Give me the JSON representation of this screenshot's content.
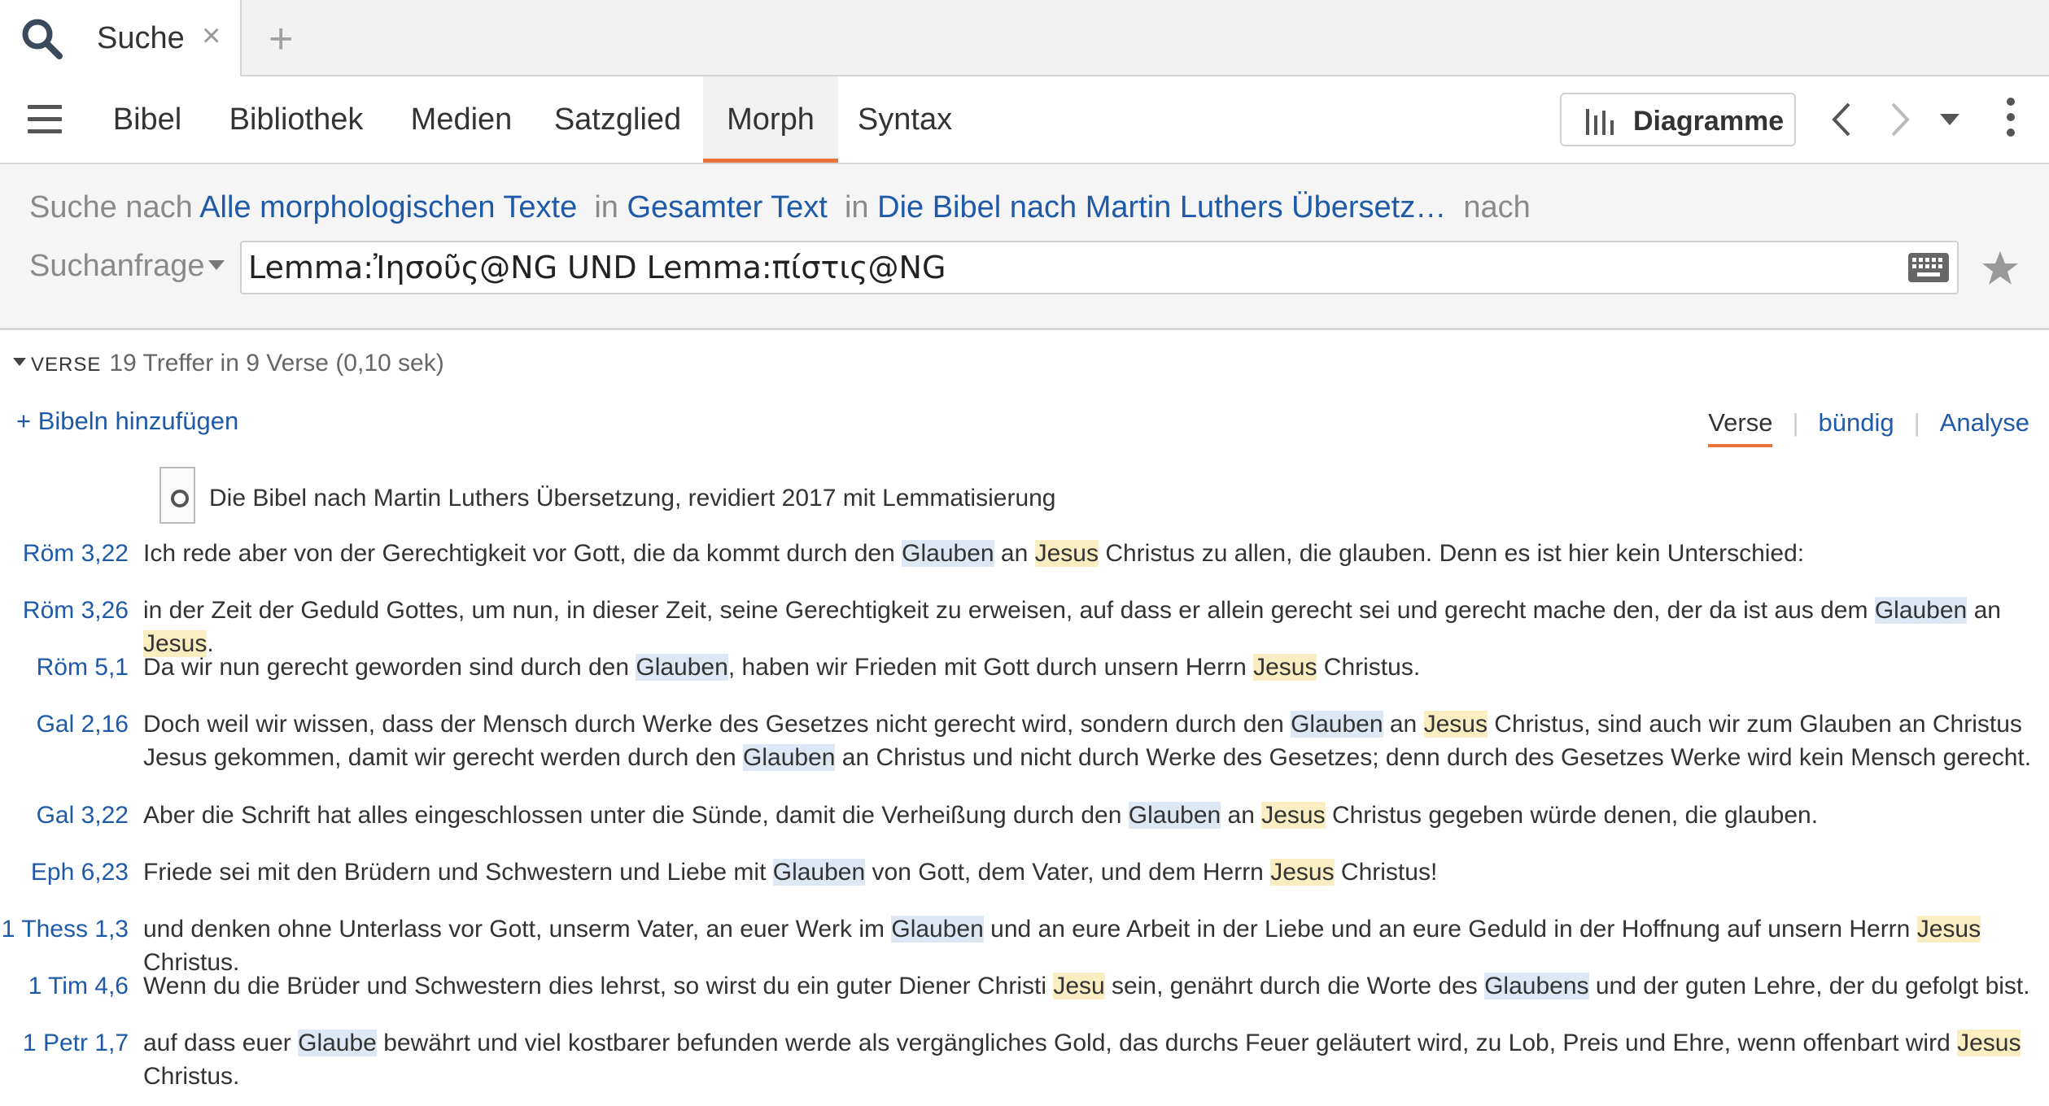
{
  "tab": {
    "title": "Suche",
    "close": "×",
    "new": "+"
  },
  "toolbar": {
    "tabs": [
      "Bibel",
      "Bibliothek",
      "Medien",
      "Satzglied",
      "Morph",
      "Syntax"
    ],
    "active_tab": "Morph",
    "diagram_label": "Diagramme"
  },
  "search": {
    "prefix": "Suche nach",
    "type": "Alle morphologischen Texte",
    "in1": "in",
    "scope": "Gesamter Text",
    "in2": "in",
    "resource": "Die Bibel nach Martin Luthers Übersetz…",
    "suffix": "nach",
    "query_label": "Suchanfrage",
    "query_value": "Lemma:Ἰησοῦς@NG UND Lemma:πίστις@NG"
  },
  "results": {
    "section": "VERSE",
    "stats": "19 Treffer in 9 Verse (0,10 sek)",
    "add_bibles": "+ Bibeln hinzufügen",
    "views": [
      "Verse",
      "bündig",
      "Analyse"
    ],
    "active_view": "Verse",
    "book_title": "Die Bibel nach Martin Luthers Übersetzung, revidiert 2017 mit Lemmatisierung",
    "verses": [
      {
        "ref": "Röm 3,22",
        "text": "Ich rede aber von der Gerechtigkeit vor Gott, die da kommt durch den [[Glauben]] an {{Jesus}} Christus zu allen, die glauben. Denn es ist hier kein Unterschied:"
      },
      {
        "ref": "Röm 3,26",
        "text": "in der Zeit der Geduld Gottes, um nun, in dieser Zeit, seine Gerechtigkeit zu erweisen, auf dass er allein gerecht sei und gerecht mache den, der da ist aus dem [[Glauben]] an {{Jesus}}."
      },
      {
        "ref": "Röm 5,1",
        "text": "Da wir nun gerecht geworden sind durch den [[Glauben]], haben wir Frieden mit Gott durch unsern Herrn {{Jesus}} Christus."
      },
      {
        "ref": "Gal 2,16",
        "text": "Doch weil wir wissen, dass der Mensch durch Werke des Gesetzes nicht gerecht wird, sondern durch den [[Glauben]] an {{Jesus}} Christus, sind auch wir zum Glauben an Christus Jesus gekommen, damit wir gerecht werden durch den [[Glauben]] an Christus und nicht durch Werke des Gesetzes; denn durch des Gesetzes Werke wird kein Mensch gerecht."
      },
      {
        "ref": "Gal 3,22",
        "text": "Aber die Schrift hat alles eingeschlossen unter die Sünde, damit die Verheißung durch den [[Glauben]] an {{Jesus}} Christus gegeben würde denen, die glauben."
      },
      {
        "ref": "Eph 6,23",
        "text": "Friede sei mit den Brüdern und Schwestern und Liebe mit [[Glauben]] von Gott, dem Vater, und dem Herrn {{Jesus}} Christus!"
      },
      {
        "ref": "1 Thess 1,3",
        "text": "und denken ohne Unterlass vor Gott, unserm Vater, an euer Werk im [[Glauben]] und an eure Arbeit in der Liebe und an eure Geduld in der Hoffnung auf unsern Herrn {{Jesus}} Christus."
      },
      {
        "ref": "1 Tim 4,6",
        "text": "Wenn du die Brüder und Schwestern dies lehrst, so wirst du ein guter Diener Christi {{Jesu}} sein, genährt durch die Worte des [[Glaubens]] und der guten Lehre, der du gefolgt bist."
      },
      {
        "ref": "1 Petr 1,7",
        "text": "auf dass euer [[Glaube]] bewährt und viel kostbarer befunden werde als vergängliches Gold, das durchs Feuer geläutert wird, zu Lob, Preis und Ehre, wenn offenbart wird {{Jesus}} Christus."
      }
    ]
  },
  "colors": {
    "accent": "#e8743b",
    "link": "#1e5aa8",
    "highlight_faith": "#dde8f4",
    "highlight_jesus": "#fbedc2"
  },
  "icons": [
    "search-icon",
    "close-icon",
    "plus-icon",
    "menu-icon",
    "bar-chart-icon",
    "chevron-left-icon",
    "chevron-right-icon",
    "caret-down-icon",
    "more-vertical-icon",
    "keyboard-icon",
    "star-icon",
    "book-cover-icon"
  ]
}
